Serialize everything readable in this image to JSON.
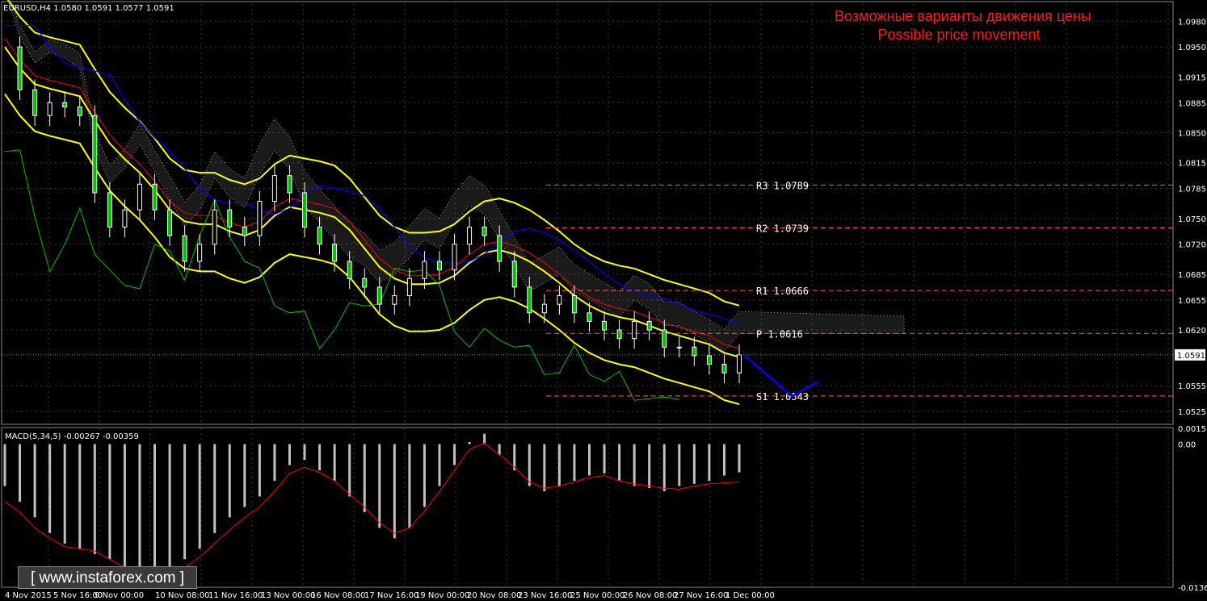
{
  "chart_data": [
    {
      "type": "candlestick",
      "symbol_header": "EURUSD,H4  1.0580 1.0591 1.0577 1.0591",
      "forecast_title_ru": "Возможные варианты движения цены",
      "forecast_title_en": "Possible price movement",
      "ylim": [
        1.051,
        1.1
      ],
      "y_ticks": [
        "1.0980",
        "1.0950",
        "1.0915",
        "1.0885",
        "1.0850",
        "1.0815",
        "1.0785",
        "1.0750",
        "1.0720",
        "1.0685",
        "1.0655",
        "1.0620",
        "1.0555",
        "1.0525"
      ],
      "current_price": "1.0591",
      "x_ticks": [
        "4 Nov 2015",
        "5 Nov 16:00",
        "9 Nov 00:00",
        "10 Nov 08:00",
        "11 Nov 16:00",
        "13 Nov 00:00",
        "16 Nov 08:00",
        "17 Nov 16:00",
        "19 Nov 00:00",
        "20 Nov 08:00",
        "23 Nov 16:00",
        "25 Nov 00:00",
        "26 Nov 08:00",
        "27 Nov 16:00",
        "1 Dec 00:00"
      ],
      "levels": [
        {
          "name": "R3",
          "label": "R3  1.0789",
          "value": 1.0789
        },
        {
          "name": "R2",
          "label": "R2  1.0739",
          "value": 1.0739
        },
        {
          "name": "R1",
          "label": "R1  1.0666",
          "value": 1.0666
        },
        {
          "name": "P",
          "label": "P  1.0616",
          "value": 1.0616
        },
        {
          "name": "S1",
          "label": "S1  1.0543",
          "value": 1.0543
        }
      ],
      "close_path": [
        1.095,
        1.09,
        1.087,
        1.0885,
        1.088,
        1.087,
        1.078,
        1.074,
        1.076,
        1.079,
        1.076,
        1.073,
        1.07,
        1.072,
        1.076,
        1.074,
        1.073,
        1.077,
        1.08,
        1.078,
        1.074,
        1.072,
        1.07,
        1.068,
        1.067,
        1.065,
        1.066,
        1.068,
        1.07,
        1.069,
        1.072,
        1.074,
        1.073,
        1.07,
        1.067,
        1.064,
        1.065,
        1.066,
        1.064,
        1.063,
        1.062,
        1.061,
        1.063,
        1.062,
        1.06,
        1.06,
        1.059,
        1.058,
        1.057,
        1.0591
      ],
      "forecast_path": [
        1.0591,
        1.0543,
        1.056
      ]
    },
    {
      "type": "histogram",
      "name": "MACD(5,34,5) -0.00267 -0.00359",
      "ylim": [
        -0.01368,
        0.00151
      ],
      "y_ticks": [
        "0.00151",
        "0.00",
        "-0.01368"
      ],
      "histogram": [
        -0.004,
        -0.0055,
        -0.007,
        -0.0085,
        -0.0095,
        -0.01,
        -0.0105,
        -0.011,
        -0.012,
        -0.0125,
        -0.013,
        -0.012,
        -0.011,
        -0.01,
        -0.0085,
        -0.007,
        -0.006,
        -0.005,
        -0.0035,
        -0.002,
        -0.0015,
        -0.0025,
        -0.0035,
        -0.005,
        -0.0065,
        -0.008,
        -0.009,
        -0.008,
        -0.006,
        -0.004,
        -0.002,
        0.0002,
        0.001,
        -0.001,
        -0.0025,
        -0.004,
        -0.0045,
        -0.004,
        -0.0035,
        -0.003,
        -0.0028,
        -0.0035,
        -0.004,
        -0.0042,
        -0.0045,
        -0.004,
        -0.0038,
        -0.0035,
        -0.003,
        -0.0027
      ],
      "signal": [
        -0.0055,
        -0.0065,
        -0.008,
        -0.009,
        -0.0098,
        -0.01,
        -0.0102,
        -0.011,
        -0.0118,
        -0.0124,
        -0.0128,
        -0.0125,
        -0.0118,
        -0.0108,
        -0.0095,
        -0.0082,
        -0.007,
        -0.006,
        -0.0045,
        -0.0028,
        -0.0022,
        -0.0027,
        -0.0035,
        -0.0048,
        -0.006,
        -0.0075,
        -0.0085,
        -0.008,
        -0.0064,
        -0.0045,
        -0.0025,
        -0.0005,
        0.0001,
        -0.001,
        -0.0022,
        -0.0036,
        -0.0042,
        -0.004,
        -0.0036,
        -0.0032,
        -0.003,
        -0.0035,
        -0.0038,
        -0.004,
        -0.0042,
        -0.0043,
        -0.004,
        -0.0038,
        -0.0037,
        -0.0036
      ]
    }
  ],
  "watermark": "[  www.instaforex.com  ]",
  "colors": {
    "grid": "#3a3a3a",
    "bull_candle": "#ffffff",
    "bear_candle": "#00c000",
    "bollinger": "#ffff00",
    "kijun": "#0000ff",
    "tenkan": "#ff0000",
    "chikou": "#00c000",
    "cloud": "#ffffff",
    "level_line": "#ff6040",
    "forecast": "#0000ff",
    "macd_hist": "#c0c0c0",
    "macd_signal": "#ff0000"
  }
}
